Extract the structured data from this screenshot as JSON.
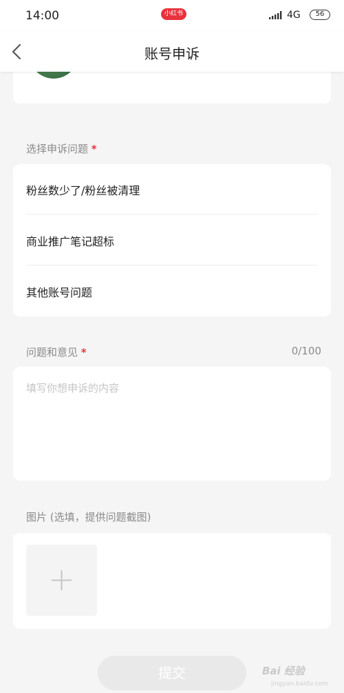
{
  "status_bar": {
    "time": "14:00",
    "app_badge": "小红书",
    "network": "4G",
    "battery": "56"
  },
  "nav": {
    "title": "账号申诉"
  },
  "issue_section": {
    "label": "选择申诉问题",
    "required": "*",
    "options": [
      {
        "label": "粉丝数少了/粉丝被清理"
      },
      {
        "label": "商业推广笔记超标"
      },
      {
        "label": "其他账号问题"
      }
    ]
  },
  "feedback_section": {
    "label": "问题和意见",
    "required": "*",
    "counter": "0/100",
    "placeholder": "填写你想申诉的内容",
    "value": ""
  },
  "image_section": {
    "label": "图片 (选填，提供问题截图)"
  },
  "submit": {
    "label": "提交"
  },
  "watermark": {
    "text": "Bai 经验",
    "sub": "jingyan.baidu.com"
  },
  "colors": {
    "accent": "#e8323c",
    "background": "#f5f5f5",
    "card": "#ffffff",
    "muted_text": "#8a8a8a",
    "submit_disabled": "#e9e9e9"
  },
  "icons": {
    "back": "chevron-left-icon",
    "signal": "signal-icon",
    "battery": "battery-icon",
    "add_image": "plus-icon"
  }
}
